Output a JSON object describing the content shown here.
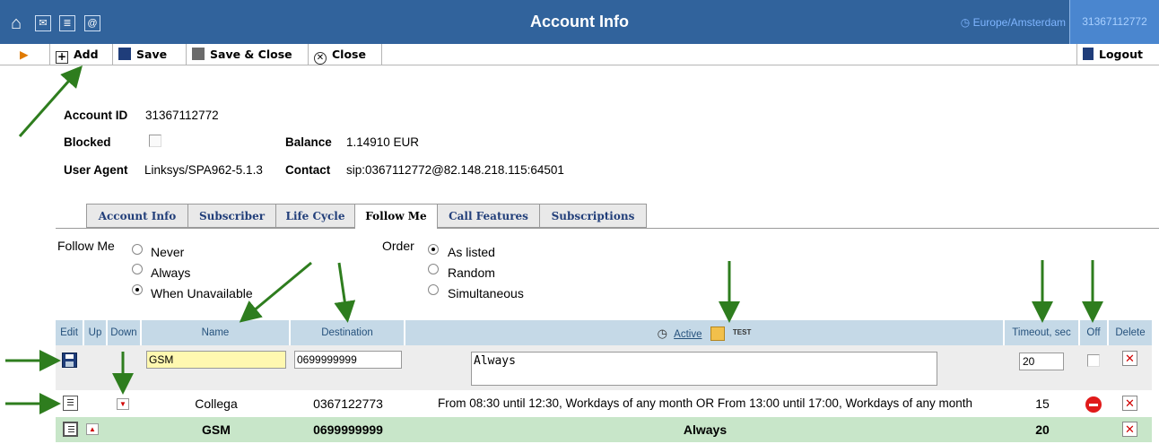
{
  "titlebar": {
    "title": "Account Info",
    "timezone": "Europe/Amsterdam",
    "account": "31367112772",
    "home_icon": "home-icon",
    "icons": [
      "mail-icon",
      "list-icon",
      "at-icon"
    ]
  },
  "toolbar": {
    "add": "Add",
    "save": "Save",
    "save_close": "Save & Close",
    "close": "Close",
    "logout": "Logout"
  },
  "info": {
    "account_id_label": "Account ID",
    "account_id": "31367112772",
    "blocked_label": "Blocked",
    "balance_label": "Balance",
    "balance": "1.14910 EUR",
    "user_agent_label": "User Agent",
    "user_agent": "Linksys/SPA962-5.1.3",
    "contact_label": "Contact",
    "contact": "sip:0367112772@82.148.218.115:64501"
  },
  "tabs": [
    "Account Info",
    "Subscriber",
    "Life Cycle",
    "Follow Me",
    "Call Features",
    "Subscriptions"
  ],
  "active_tab": "Follow Me",
  "follow_me": {
    "label": "Follow Me",
    "options": [
      "Never",
      "Always",
      "When Unavailable"
    ],
    "selected": "When Unavailable"
  },
  "order": {
    "label": "Order",
    "options": [
      "As listed",
      "Random",
      "Simultaneous"
    ],
    "selected": "As listed"
  },
  "table": {
    "headers": {
      "edit": "Edit",
      "up": "Up",
      "down": "Down",
      "name": "Name",
      "destination": "Destination",
      "active": "Active",
      "test": "TEST",
      "timeout": "Timeout, sec",
      "off": "Off",
      "delete": "Delete"
    },
    "edit_row": {
      "name": "GSM",
      "destination": "0699999999",
      "active": "Always",
      "timeout": "20"
    },
    "rows": [
      {
        "name": "Collega",
        "destination": "0367122773",
        "active": "From 08:30 until 12:30, Workdays of any month OR From 13:00 until 17:00, Workdays of any month",
        "timeout": "15"
      },
      {
        "name": "GSM",
        "destination": "0699999999",
        "active": "Always",
        "timeout": "20"
      }
    ]
  },
  "colors": {
    "titlebar": "#31639c",
    "header_cell": "#c5d9e7",
    "highlight_row": "#c8e6c9",
    "arrow": "#2e7d1e"
  }
}
